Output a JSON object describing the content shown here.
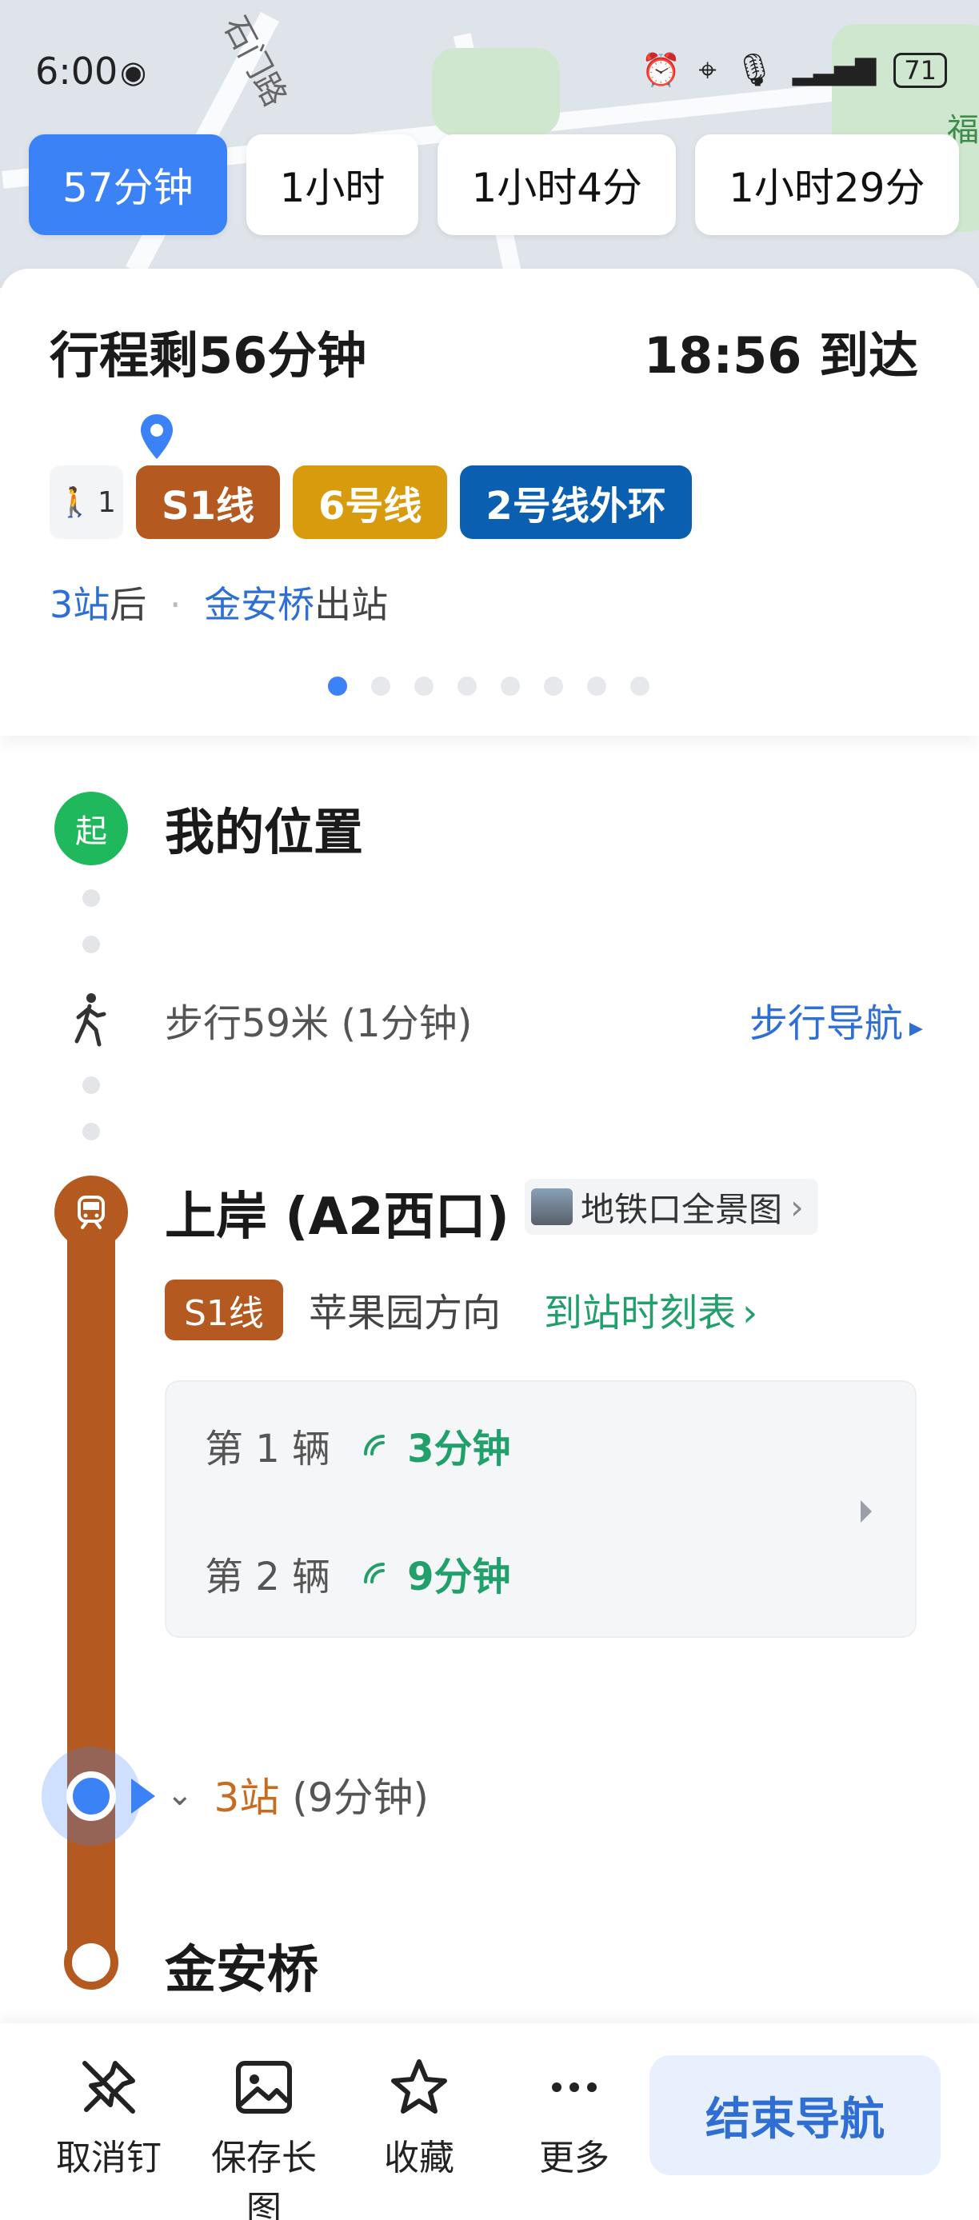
{
  "status_bar": {
    "time": "6:00",
    "battery": "71"
  },
  "map": {
    "road_label": "石门路",
    "poi_label": "福"
  },
  "route_tabs": [
    {
      "label": "57分钟",
      "active": true
    },
    {
      "label": "1小时",
      "active": false
    },
    {
      "label": "1小时4分",
      "active": false
    },
    {
      "label": "1小时29分",
      "active": false
    }
  ],
  "summary": {
    "remaining": "行程剩56分钟",
    "arrival": "18:56 到达",
    "walk_segment": "1",
    "lines": [
      {
        "label": "S1线",
        "color": "#b45a20"
      },
      {
        "label": "6号线",
        "color": "#d89b0e"
      },
      {
        "label": "2号线外环",
        "color": "#0b5fb0"
      }
    ],
    "stops_after": "3站",
    "after_word": "后",
    "exit_station": "金安桥",
    "exit_word": "出站",
    "page_count": 8,
    "active_page": 1
  },
  "timeline": {
    "start_badge": "起",
    "start_title": "我的位置",
    "walk_text": "步行59米 (1分钟)",
    "walk_nav": "步行导航",
    "station_title": "上岸 (A2西口)",
    "panorama_label": "地铁口全景图",
    "line_label": "S1线",
    "direction": "苹果园方向",
    "timetable_label": "到站时刻表",
    "arrivals": [
      {
        "label": "第 1 辆",
        "eta": "3分钟"
      },
      {
        "label": "第 2 辆",
        "eta": "9分钟"
      }
    ],
    "stops_count": "3站",
    "stops_time": "(9分钟)",
    "end_title": "金安桥"
  },
  "bottom_bar": {
    "unpin": "取消钉",
    "save_image": "保存长图",
    "favorite": "收藏",
    "more": "更多",
    "end_nav": "结束导航"
  },
  "colors": {
    "accent_blue": "#3b82f6",
    "s1_line": "#b45a20",
    "green": "#22a06b"
  }
}
